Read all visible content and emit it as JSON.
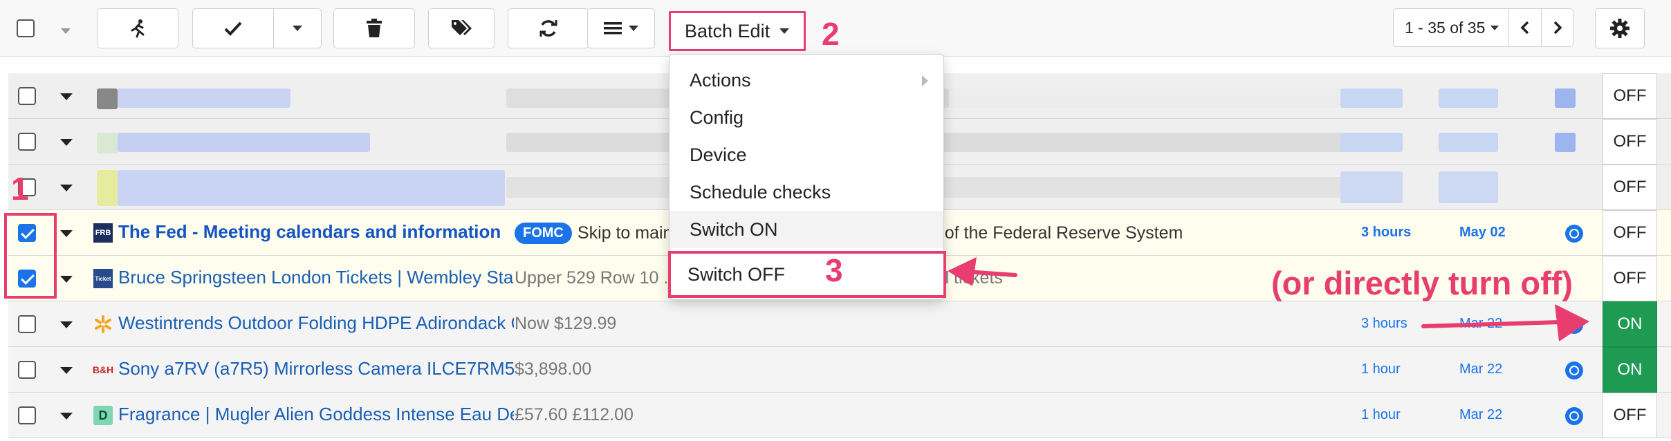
{
  "toolbar": {
    "batch_edit_label": "Batch Edit",
    "pager_label": "1 - 35 of 35",
    "icons": [
      "running-icon",
      "checkmark-icon",
      "trash-icon",
      "tag-icon",
      "refresh-icon",
      "list-icon",
      "gear-icon"
    ]
  },
  "batch_menu": {
    "items": [
      {
        "label": "Actions",
        "submenu": true
      },
      {
        "label": "Config"
      },
      {
        "label": "Device"
      },
      {
        "label": "Schedule checks"
      },
      {
        "label": "Switch ON"
      },
      {
        "label": "Switch OFF"
      }
    ]
  },
  "rows": [
    {
      "checked": false,
      "title": "",
      "snippet": "",
      "age": "",
      "date": "",
      "toggle": "OFF",
      "blurred": true
    },
    {
      "checked": false,
      "title": "",
      "snippet": "",
      "age": "",
      "date": "",
      "toggle": "OFF",
      "blurred": true
    },
    {
      "checked": false,
      "title": "",
      "snippet": "",
      "age": "",
      "date": "",
      "toggle": "OFF",
      "blurred": true
    },
    {
      "checked": true,
      "favicon": "FRB",
      "title": "The Fed - Meeting calendars and information",
      "tag": "FOMC",
      "snippet": "Skip to main content ... about the Fed Structure of the Federal Reserve System",
      "age": "3 hours",
      "date": "May 02",
      "toggle": "OFF"
    },
    {
      "checked": true,
      "favicon": "Ticket",
      "title": "Bruce Springsteen London Tickets | Wembley Stadium",
      "snippet": "Upper 529 Row 10 ... Upper 551 Row 381 - 5 tickets Sell tickets",
      "age": "",
      "date": "",
      "toggle": "OFF"
    },
    {
      "checked": false,
      "favicon": "walmart-spark-icon",
      "title": "Westintrends Outdoor Folding HDPE Adirondack Chair",
      "snippet": "Now $129.99",
      "age": "3 hours",
      "date": "Mar 22",
      "toggle": "ON"
    },
    {
      "checked": false,
      "favicon": "B&H",
      "title": "Sony a7RV (a7R5) Mirrorless Camera ILCE7RM5",
      "snippet": "$3,898.00",
      "age": "1 hour",
      "date": "Mar 22",
      "toggle": "ON"
    },
    {
      "checked": false,
      "favicon": "D",
      "title": "Fragrance | Mugler Alien Goddess Intense Eau De Parfum",
      "snippet": "£57.60 £112.00",
      "age": "1 hour",
      "date": "Mar 22",
      "toggle": "OFF"
    }
  ],
  "annotations": {
    "step1": "1",
    "step2": "2",
    "step3": "3",
    "note": "(or directly turn off)",
    "accent_color": "#e73d6f"
  },
  "colors": {
    "link": "#1a5fb4",
    "on_green": "#1e9a53",
    "selected_row": "#fefdee"
  }
}
